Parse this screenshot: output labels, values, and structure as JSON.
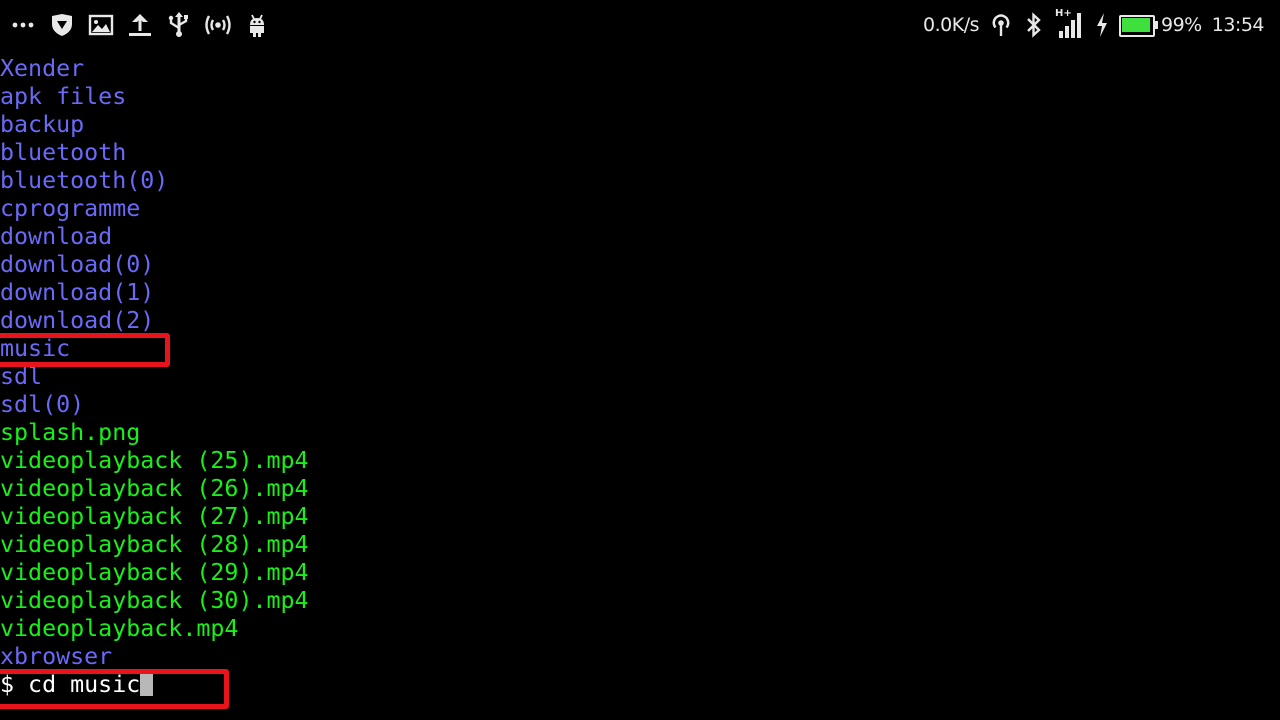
{
  "status_bar": {
    "left_icons": [
      "more-icon",
      "shield-icon",
      "image-icon",
      "upload-icon",
      "usb-icon",
      "hotspot-icon",
      "android-icon"
    ],
    "net_speed": "0.0K/s",
    "network_type": "H+",
    "battery_percent_text": "99%",
    "battery_level": 0.99,
    "time": "13:54",
    "battery_color": "#3ee03e"
  },
  "terminal": {
    "colors": {
      "directory": "#6a6af6",
      "file": "#19f019",
      "highlight": "#e8141b"
    },
    "entries": [
      {
        "name": "Xender",
        "type": "dir"
      },
      {
        "name": "apk files",
        "type": "dir"
      },
      {
        "name": "backup",
        "type": "dir"
      },
      {
        "name": "bluetooth",
        "type": "dir"
      },
      {
        "name": "bluetooth(0)",
        "type": "dir"
      },
      {
        "name": "cprogramme",
        "type": "dir"
      },
      {
        "name": "download",
        "type": "dir"
      },
      {
        "name": "download(0)",
        "type": "dir"
      },
      {
        "name": "download(1)",
        "type": "dir"
      },
      {
        "name": "download(2)",
        "type": "dir"
      },
      {
        "name": "music",
        "type": "dir"
      },
      {
        "name": "sdl",
        "type": "dir"
      },
      {
        "name": "sdl(0)",
        "type": "dir"
      },
      {
        "name": "splash.png",
        "type": "file"
      },
      {
        "name": "videoplayback (25).mp4",
        "type": "file"
      },
      {
        "name": "videoplayback (26).mp4",
        "type": "file"
      },
      {
        "name": "videoplayback (27).mp4",
        "type": "file"
      },
      {
        "name": "videoplayback (28).mp4",
        "type": "file"
      },
      {
        "name": "videoplayback (29).mp4",
        "type": "file"
      },
      {
        "name": "videoplayback (30).mp4",
        "type": "file"
      },
      {
        "name": "videoplayback.mp4",
        "type": "file"
      },
      {
        "name": "xbrowser",
        "type": "dir"
      }
    ],
    "prompt": "$ cd music"
  }
}
